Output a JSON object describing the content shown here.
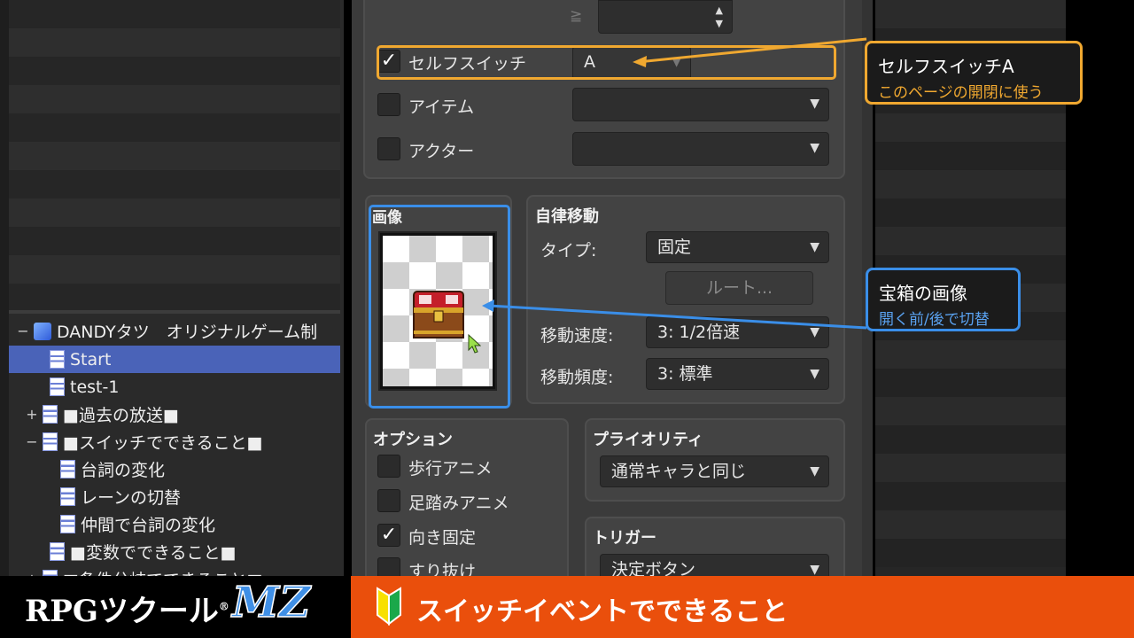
{
  "left_tree": {
    "items": [
      {
        "label": "DANDYタツ　オリジナルゲーム制",
        "expander": "−",
        "kind": "map"
      },
      {
        "label": "Start",
        "kind": "doc",
        "selected": true
      },
      {
        "label": "test-1",
        "kind": "doc"
      },
      {
        "label": "■過去の放送■",
        "expander": "+",
        "kind": "doc"
      },
      {
        "label": "■スイッチでできること■",
        "expander": "−",
        "kind": "doc"
      },
      {
        "label": "台詞の変化",
        "kind": "doc"
      },
      {
        "label": "レーンの切替",
        "kind": "doc"
      },
      {
        "label": "仲間で台詞の変化",
        "kind": "doc"
      },
      {
        "label": "■変数でできること■",
        "kind": "doc"
      },
      {
        "label": "■条件分岐でできること■",
        "expander": "+",
        "kind": "doc"
      }
    ]
  },
  "conditions": {
    "ge_symbol": "≧",
    "self_switch": {
      "label": "セルフスイッチ",
      "checked": true,
      "value": "A"
    },
    "item": {
      "label": "アイテム",
      "checked": false
    },
    "actor": {
      "label": "アクター",
      "checked": false
    }
  },
  "image_group": {
    "title": "画像"
  },
  "autonomous": {
    "title": "自律移動",
    "type_label": "タイプ:",
    "type_value": "固定",
    "route_button": "ルート...",
    "speed_label": "移動速度:",
    "speed_value": "3: 1/2倍速",
    "freq_label": "移動頻度:",
    "freq_value": "3: 標準"
  },
  "options": {
    "title": "オプション",
    "walking": {
      "label": "歩行アニメ",
      "checked": false
    },
    "stepping": {
      "label": "足踏みアニメ",
      "checked": false
    },
    "direction_fix": {
      "label": "向き固定",
      "checked": true
    },
    "through": {
      "label": "すり抜け",
      "checked": false
    }
  },
  "priority": {
    "title": "プライオリティ",
    "value": "通常キャラと同じ"
  },
  "trigger": {
    "title": "トリガー",
    "value": "決定ボタン"
  },
  "callouts": {
    "self_switch": {
      "title": "セルフスイッチA",
      "sub": "このページの開閉に使う",
      "color": "#f0a830"
    },
    "image": {
      "title": "宝箱の画像",
      "sub": "開く前/後で切替",
      "color": "#3a8ee8"
    }
  },
  "banner": {
    "logo": "RPGツクール",
    "logo_mark": "®",
    "logo_mz": "MZ",
    "title": "スイッチイベントでできること",
    "color": "#ea4f0c"
  },
  "icons": [
    "check-icon",
    "dropdown-arrow-icon",
    "spinner-arrows-icon",
    "map-icon",
    "doc-icon",
    "beginner-mark-icon",
    "cursor-icon",
    "treasure-chest-icon"
  ]
}
